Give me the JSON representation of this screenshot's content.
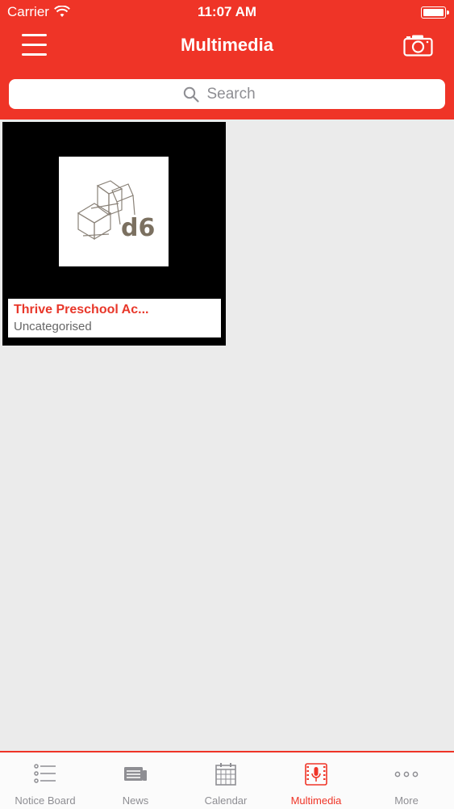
{
  "status_bar": {
    "carrier": "Carrier",
    "time": "11:07 AM"
  },
  "header": {
    "title": "Multimedia"
  },
  "search": {
    "placeholder": "Search"
  },
  "media_items": [
    {
      "title": "Thrive Preschool Ac...",
      "category": "Uncategorised",
      "logo_text": "d6"
    }
  ],
  "tabs": [
    {
      "label": "Notice Board",
      "icon": "notice-board-icon"
    },
    {
      "label": "News",
      "icon": "news-icon"
    },
    {
      "label": "Calendar",
      "icon": "calendar-icon"
    },
    {
      "label": "Multimedia",
      "icon": "multimedia-icon",
      "active": true
    },
    {
      "label": "More",
      "icon": "more-icon"
    }
  ],
  "colors": {
    "accent": "#ef3427",
    "background": "#ebebeb",
    "tab_inactive": "#8e8e93"
  }
}
